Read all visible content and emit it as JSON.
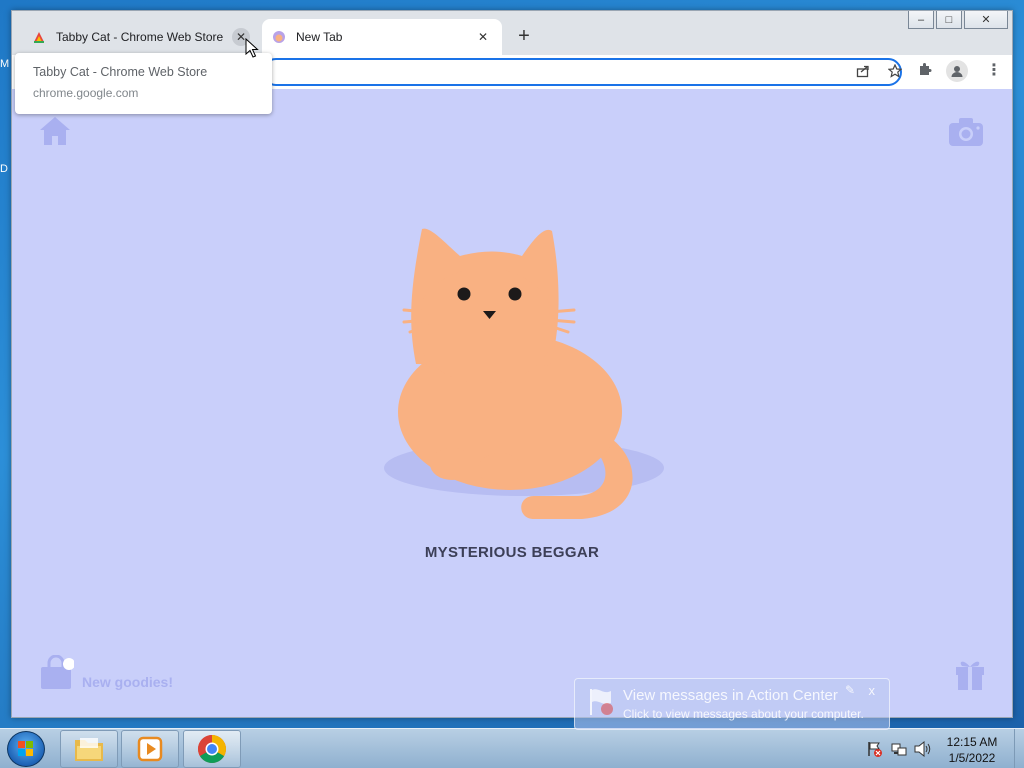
{
  "desktop": {
    "edge_glyphs": [
      "M",
      "D"
    ]
  },
  "window": {
    "controls": {
      "minimize": "–",
      "maximize": "□",
      "close": "✕"
    }
  },
  "tabs": [
    {
      "title": "Tabby Cat - Chrome Web Store",
      "close": "✕",
      "active": false
    },
    {
      "title": "New Tab",
      "close": "✕",
      "active": true
    }
  ],
  "new_tab_button": "+",
  "tooltip": {
    "title": "Tabby Cat - Chrome Web Store",
    "url": "chrome.google.com"
  },
  "toolbar": {
    "icons": [
      "share-icon",
      "star-icon",
      "extensions-icon",
      "profile-icon",
      "menu-icon"
    ],
    "menu": "⋮"
  },
  "page": {
    "background_color": "#c9cffa",
    "cat_color": "#f9b182",
    "pet_name": "MYSTERIOUS BEGGAR",
    "goodies_label": "New goodies!",
    "icons": [
      "home-icon",
      "camera-icon",
      "bag-icon",
      "gift-icon"
    ]
  },
  "balloon": {
    "title": "View messages in Action Center",
    "subtitle": "Click to view messages about your computer.",
    "close": "x"
  },
  "taskbar": {
    "apps": [
      "explorer",
      "media-player",
      "chrome"
    ],
    "clock": {
      "time": "12:15 AM",
      "date": "1/5/2022"
    }
  }
}
